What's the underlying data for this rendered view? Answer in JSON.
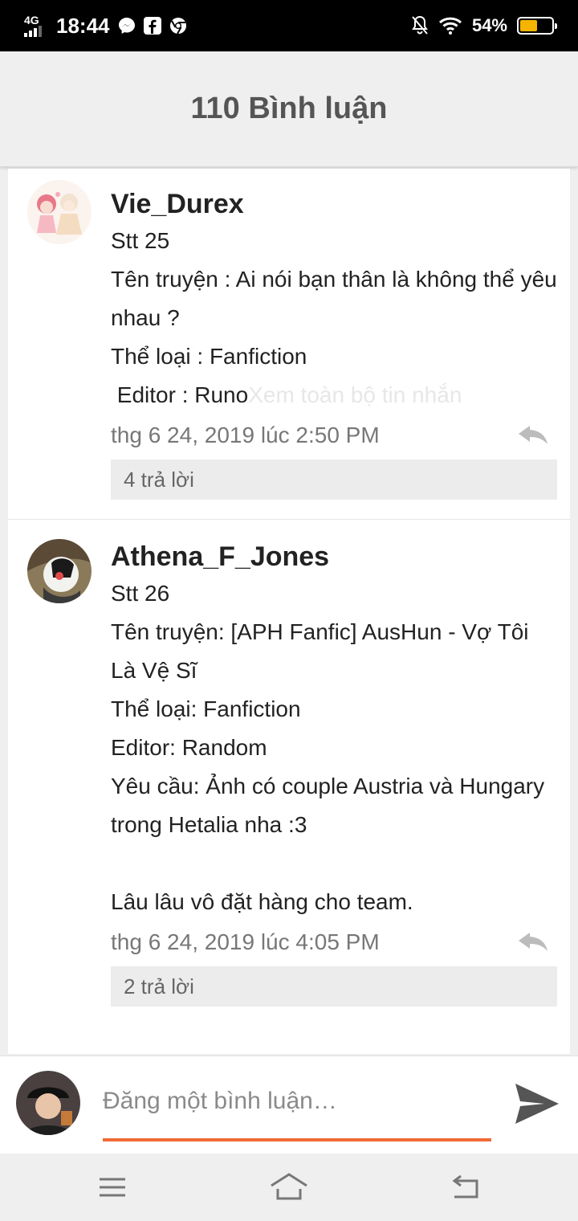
{
  "status_bar": {
    "network": "4G",
    "time": "18:44",
    "battery_percent": "54%",
    "battery_level": 0.54,
    "icons": [
      "messenger-icon",
      "facebook-icon",
      "chrome-icon",
      "mute-icon",
      "wifi-icon",
      "battery-icon"
    ]
  },
  "header": {
    "title": "110 Bình luận"
  },
  "comments": [
    {
      "username": "Vie_Durex",
      "lines": [
        "Stt 25",
        "Tên truyện : Ai nói bạn thân là không thể yêu nhau ?",
        "Thể loại : Fanfiction",
        " Editor : Runo"
      ],
      "see_more": "Xem toàn bộ tin nhắn",
      "timestamp": "thg 6 24, 2019 lúc 2:50 PM",
      "replies": "4 trả lời"
    },
    {
      "username": "Athena_F_Jones",
      "lines": [
        "Stt 26",
        "Tên truyện: [APH Fanfic] AusHun - Vợ Tôi Là Vệ Sĩ",
        "Thể loại: Fanfiction",
        "Editor: Random",
        "Yêu cầu: Ảnh có couple Austria và Hungary trong Hetalia nha :3",
        "",
        "Lâu lâu vô đặt hàng cho team."
      ],
      "timestamp": "thg 6 24, 2019 lúc 4:05 PM",
      "replies": "2 trả lời"
    }
  ],
  "compose": {
    "placeholder": "Đăng một bình luận…"
  },
  "colors": {
    "accent": "#f06a35",
    "battery": "#f5b400"
  }
}
